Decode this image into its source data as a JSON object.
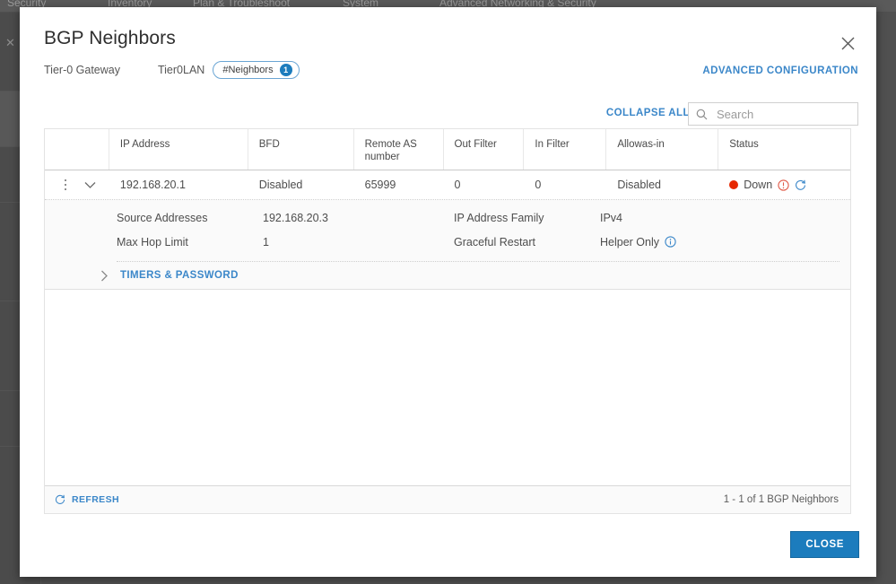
{
  "backdrop": {
    "nav_items": [
      "Security",
      "Inventory",
      "Plan & Troubleshoot",
      "System",
      "Advanced Networking & Security"
    ],
    "back_icon": "chevron-left-icon"
  },
  "modal": {
    "title": "BGP Neighbors",
    "close_icon": "close-icon",
    "subline": {
      "gateway_type": "Tier-0 Gateway",
      "gateway_name": "Tier0LAN",
      "chip_label": "#Neighbors",
      "chip_count": "1"
    },
    "advanced_configuration_label": "ADVANCED CONFIGURATION",
    "close_button_label": "CLOSE"
  },
  "toolbar": {
    "collapse_all_label": "COLLAPSE ALL",
    "search_placeholder": "Search",
    "search_value": "",
    "search_icon": "search-icon"
  },
  "grid": {
    "columns": [
      {
        "key": "actions",
        "label": ""
      },
      {
        "key": "ip_address",
        "label": "IP Address"
      },
      {
        "key": "bfd",
        "label": "BFD"
      },
      {
        "key": "remote_as",
        "label": "Remote AS number"
      },
      {
        "key": "out_filter",
        "label": "Out Filter"
      },
      {
        "key": "in_filter",
        "label": "In Filter"
      },
      {
        "key": "allowas_in",
        "label": "Allowas-in"
      },
      {
        "key": "status",
        "label": "Status"
      }
    ],
    "rows": [
      {
        "ip_address": "192.168.20.1",
        "bfd": "Disabled",
        "remote_as": "65999",
        "out_filter": "0",
        "in_filter": "0",
        "allowas_in": "Disabled",
        "status_text": "Down",
        "status_color": "#e62700",
        "status_alert_icon": "error-circle-icon",
        "status_refresh_icon": "refresh-icon",
        "kebab_icon": "overflow-menu-icon",
        "expand_icon": "chevron-down-icon"
      }
    ],
    "detail": {
      "left": [
        {
          "label": "Source Addresses",
          "value": "192.168.20.3"
        },
        {
          "label": "Max Hop Limit",
          "value": "1"
        }
      ],
      "right": [
        {
          "label": "IP Address Family",
          "value": "IPv4",
          "info_icon": ""
        },
        {
          "label": "Graceful Restart",
          "value": "Helper Only",
          "info_icon": "info-circle-icon"
        }
      ],
      "timers_label": "TIMERS & PASSWORD",
      "timers_icon": "chevron-right-icon"
    },
    "footer": {
      "refresh_label": "REFRESH",
      "refresh_icon": "refresh-icon",
      "pager_text": "1 - 1 of 1 BGP Neighbors"
    }
  },
  "colors": {
    "accent_blue": "#3b87c9",
    "button_blue": "#1c7cbd",
    "status_red": "#e62700"
  }
}
